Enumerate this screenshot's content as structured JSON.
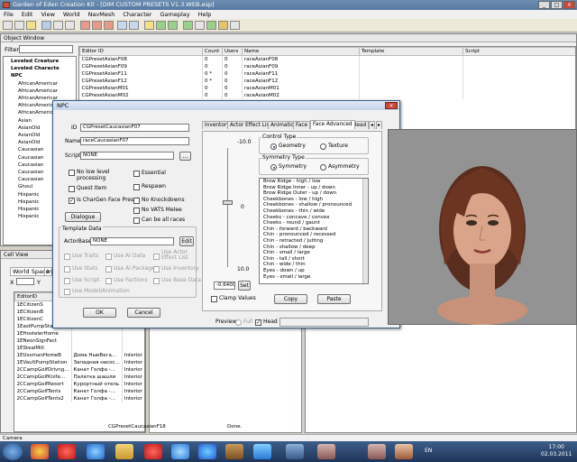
{
  "window": {
    "title": "Garden of Eden Creation Kit - [DIM CUSTOM PRESETS V1.3.WEB.esp]"
  },
  "menu": [
    "File",
    "Edit",
    "View",
    "World",
    "NavMesh",
    "Character",
    "Gameplay",
    "Help"
  ],
  "object_window": {
    "title": "Object Window",
    "filter_label": "Filter",
    "tree": [
      "Leveled Creature",
      "Leveled Characte",
      "NPC",
      "AfricanAmericar",
      "AfricanAmericar",
      "AfricanAmericar",
      "AfricanAmericar",
      "AfricanAmericar",
      "Asian",
      "AsianOld",
      "AsianOld",
      "AsianOld",
      "Caucasian",
      "Caucasian",
      "Caucasian",
      "Caucasian",
      "Caucasian",
      "Ghoul",
      "Hispanic",
      "Hispanic",
      "Hispanic",
      "Hispanic"
    ],
    "columns": [
      "Editor ID",
      "Count",
      "Users",
      "Name",
      "Template",
      "Script"
    ],
    "rows": [
      [
        "CGPresetAsianF08",
        "0",
        "0",
        "raceAsianF08"
      ],
      [
        "CGPresetAsianF09",
        "0",
        "0",
        "raceAsianF09"
      ],
      [
        "CGPresetAsianF11",
        "0 *",
        "0",
        "raceAsianF11"
      ],
      [
        "CGPresetAsianF12",
        "0 *",
        "0",
        "raceAsianF12"
      ],
      [
        "CGPresetAsianM01",
        "0",
        "0",
        "raceAsianM01"
      ],
      [
        "CGPresetAsianM02",
        "0",
        "0",
        "raceAsianM02"
      ]
    ]
  },
  "cell_view": {
    "title": "Cell View",
    "tab_world": "World Space",
    "tab_interior": "Inte",
    "x_label": "X",
    "y_label": "Y",
    "column": "EditorID",
    "rows": [
      [
        "1ECitizenS",
        "",
        ""
      ],
      [
        "1ECitizenB",
        "",
        ""
      ],
      [
        "1ECitizenC",
        "",
        ""
      ],
      [
        "1EastPumpStati",
        "",
        ""
      ],
      [
        "1EHostelerHome",
        "",
        ""
      ],
      [
        "1ENeonSignFact",
        "",
        ""
      ],
      [
        "1EStealMill",
        "",
        ""
      ],
      [
        "1EUsomanHomeB",
        "Домa НьюВега...",
        "Interior"
      ],
      [
        "1EVaultPumpStation",
        "Западная насос...",
        "Interior"
      ],
      [
        "2CCampGolfDrivng...",
        "Канат Голфа -...",
        "Interior"
      ],
      [
        "2CCampGolfKnife...",
        "Палатка шашли",
        "Interior"
      ],
      [
        "2CCampGolfResort",
        "Курортный отель",
        "Interior"
      ],
      [
        "2CCampGolfTents",
        "Канат Голфа -...",
        "Interior"
      ],
      [
        "2CCampGolfTents2",
        "Канат Голфа -...",
        "Interior"
      ]
    ]
  },
  "npc_dialog": {
    "title": "NPC",
    "id_label": "ID",
    "id_value": "CGPresetCaucasianF07",
    "name_label": "Name",
    "name_value": "raceCaucasianF07",
    "script_label": "Script",
    "script_value": "NONE",
    "script_btn": "...",
    "checks": [
      {
        "label": "No low level processing",
        "checked": false
      },
      {
        "label": "Essential",
        "checked": false
      },
      {
        "label": "Quest Item",
        "checked": false
      },
      {
        "label": "Respawn",
        "checked": false
      },
      {
        "label": "Is CharGen Face Preset",
        "checked": true
      },
      {
        "label": "No Knockdowns",
        "checked": false
      },
      {
        "label": "No VATS Melee",
        "checked": false
      },
      {
        "label": "Can be all races",
        "checked": false
      }
    ],
    "dialogue_btn": "Dialogue",
    "template_title": "Template Data",
    "actor_base_label": "ActorBase",
    "actor_base_value": "NONE",
    "edit_btn": "Edit",
    "template_checks": [
      "Use Traits",
      "Use AI Data",
      "Use Actor Effect List",
      "Use Stats",
      "Use AI Packages",
      "Use Inventory",
      "Use Script",
      "Use Factions",
      "Use Base Data",
      "Use Model/Animation"
    ],
    "ok_btn": "OK",
    "cancel_btn": "Cancel",
    "tabs": [
      "Inventory",
      "Actor Effect List",
      "Animation",
      "Face",
      "Face Advanced",
      "Head"
    ],
    "slider_top": "-10.0",
    "slider_mid": "0",
    "slider_bottom": "10.0",
    "slider_value": "-0.6400",
    "set_btn": "Set",
    "control_type_title": "Control Type",
    "geometry_label": "Geometry",
    "texture_label": "Texture",
    "symmetry_title": "Symmetry Type",
    "symmetry_label": "Symmetry",
    "asymmetry_label": "Asymmetry",
    "morphs": [
      "Brow Ridge - high / low",
      "Brow Ridge Inner - up / down",
      "Brow Ridge Outer - up / down",
      "Cheekbones - low / high",
      "Cheekbones - shallow / pronounced",
      "Cheekbones - thin / wide",
      "Cheeks - concave / convex",
      "Cheeks - round / gaunt",
      "Chin - forward / backward",
      "Chin - pronounced / recessed",
      "Chin - retracted / jutting",
      "Chin - shallow / deep",
      "Chin - small / large",
      "Chin - tall / short",
      "Chin - wide / thin",
      "Eyes - down / up",
      "Eyes - small / large"
    ],
    "clamp_label": "Clamp Values",
    "copy_btn": "Copy",
    "paste_btn": "Paste",
    "preview_label": "Preview",
    "full_label": "Full",
    "head_label": "Head"
  },
  "render_window": {
    "editor_id": "CGPresetCaucasianF18",
    "status": "Done."
  },
  "statusbar": {
    "left": "Camera"
  },
  "taskbar": {
    "lang": "EN",
    "time": "17:00",
    "date": "02.03.2011"
  }
}
